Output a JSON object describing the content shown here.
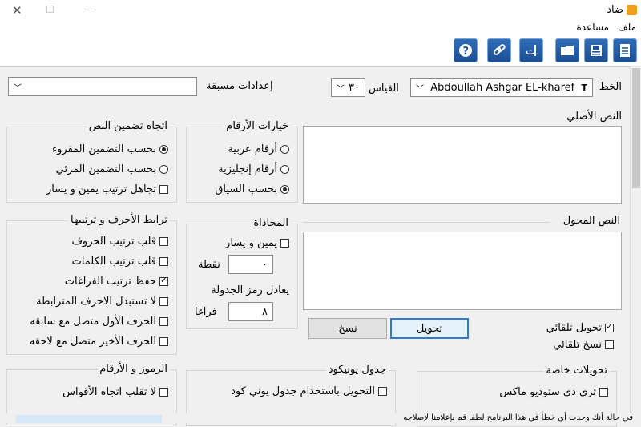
{
  "window": {
    "title": "ضاد"
  },
  "menu": {
    "file": "ملف",
    "help": "مساعدة"
  },
  "font": {
    "label": "الخط",
    "value": "Abdoullah Ashgar EL-kharef"
  },
  "size": {
    "label": "القياس",
    "value": "٣٠"
  },
  "presets": {
    "label": "إعدادات مسبقة",
    "value": ""
  },
  "original_text": {
    "label": "النص الأصلي"
  },
  "converted_text": {
    "label": "النص المحول"
  },
  "embed_direction": {
    "title": "اتجاه تضمين النص",
    "opt1": "بحسب التضمين المقروء",
    "opt2": "بحسب التضمين المرئي",
    "opt3": "تجاهل ترتيب يمين و يسار"
  },
  "numbers_options": {
    "title": "خيارات الأرقام",
    "opt1": "أرقام عربية",
    "opt2": "أرقام إنجليزية",
    "opt3": "بحسب السياق"
  },
  "letters": {
    "title": "ترابط الأحرف و ترتيبها",
    "opt1": "قلب ترتيب الحروف",
    "opt2": "قلب ترتيب الكلمات",
    "opt3": "حفظ ترتيب الفراغات",
    "opt4": "لا تستبدل الاحرف المترابطة",
    "opt5": "الحرف الأول متصل مع سابقه",
    "opt6": "الحرف الأخير متصل مع لاحقه"
  },
  "alignment": {
    "title": "المحاذاة",
    "rtl": "يمين و يسار",
    "point_label": "نقطة",
    "point_value": "٠",
    "tab_label": "يعادل رمز الجدولة",
    "spaces_label": "فراغا",
    "spaces_value": "٨"
  },
  "actions": {
    "convert": "تحويل",
    "copy": "نسخ",
    "auto_convert": "تحويل تلقائي",
    "auto_copy": "نسخ تلقائي"
  },
  "symbols": {
    "title": "الرموز و الأرقام",
    "opt1": "لا تقلب اتجاه الأقواس"
  },
  "unicode": {
    "title": "جدول يونيكود",
    "opt1": "التحويل باستخدام جدول يوني كود"
  },
  "special": {
    "title": "تحويلات خاصة",
    "opt1": "ثري دي ستوديو ماكس"
  },
  "status": {
    "text": "في حالة أنك وجدت أي خطأ في هذا البرنامج لطفا قم بإعلامنا لإصلاحه"
  },
  "colors": {
    "accent": "#2f7bd4",
    "toolbar_icon": "#1d4f93"
  }
}
